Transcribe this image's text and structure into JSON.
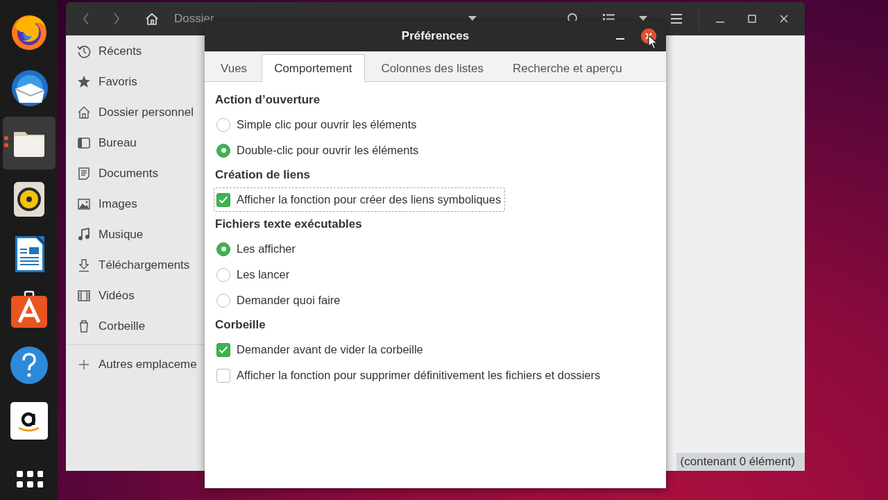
{
  "dock": {
    "items": [
      {
        "kind": "firefox",
        "running": false
      },
      {
        "kind": "thunderbird",
        "running": false
      },
      {
        "kind": "files",
        "running": true
      },
      {
        "kind": "rhythmbox",
        "running": false
      },
      {
        "kind": "writer",
        "running": false
      },
      {
        "kind": "software",
        "running": false
      },
      {
        "kind": "help",
        "running": false
      },
      {
        "kind": "amazon",
        "running": false
      },
      {
        "kind": "apps",
        "running": false
      }
    ]
  },
  "file_manager": {
    "path": [
      "Dossier"
    ],
    "sidebar": [
      {
        "label": "Récents"
      },
      {
        "label": "Favoris"
      },
      {
        "label": "Dossier personnel"
      },
      {
        "label": "Bureau"
      },
      {
        "label": "Documents"
      },
      {
        "label": "Images"
      },
      {
        "label": "Musique"
      },
      {
        "label": "Téléchargements"
      },
      {
        "label": "Vidéos"
      },
      {
        "label": "Corbeille"
      }
    ],
    "other_locations": "Autres emplaceme",
    "status": "(contenant 0 élément)"
  },
  "dialog": {
    "title": "Préférences",
    "tabs": [
      {
        "label": "Vues",
        "selected": false
      },
      {
        "label": "Comportement",
        "selected": true
      },
      {
        "label": "Colonnes des listes",
        "selected": false
      },
      {
        "label": "Recherche et aperçu",
        "selected": false
      }
    ],
    "sections": [
      {
        "heading": "Action d’ouverture",
        "options": [
          {
            "kind": "radio",
            "label": "Simple clic pour ouvrir les éléments",
            "selected": false,
            "focused": false
          },
          {
            "kind": "radio",
            "label": "Double-clic pour ouvrir les éléments",
            "selected": true,
            "focused": false
          }
        ]
      },
      {
        "heading": "Création de liens",
        "options": [
          {
            "kind": "checkbox",
            "label": "Afficher la fonction pour créer des liens symboliques",
            "checked": true,
            "focused": true
          }
        ]
      },
      {
        "heading": "Fichiers texte exécutables",
        "options": [
          {
            "kind": "radio",
            "label": "Les afficher",
            "selected": true,
            "focused": false
          },
          {
            "kind": "radio",
            "label": "Les lancer",
            "selected": false,
            "focused": false
          },
          {
            "kind": "radio",
            "label": "Demander quoi faire",
            "selected": false,
            "focused": false
          }
        ]
      },
      {
        "heading": "Corbeille",
        "options": [
          {
            "kind": "checkbox",
            "label": "Demander avant de vider la corbeille",
            "checked": true,
            "focused": false
          },
          {
            "kind": "checkbox",
            "label": "Afficher la fonction pour supprimer définitivement les fichiers et dossiers",
            "checked": false,
            "focused": false
          }
        ]
      }
    ]
  }
}
